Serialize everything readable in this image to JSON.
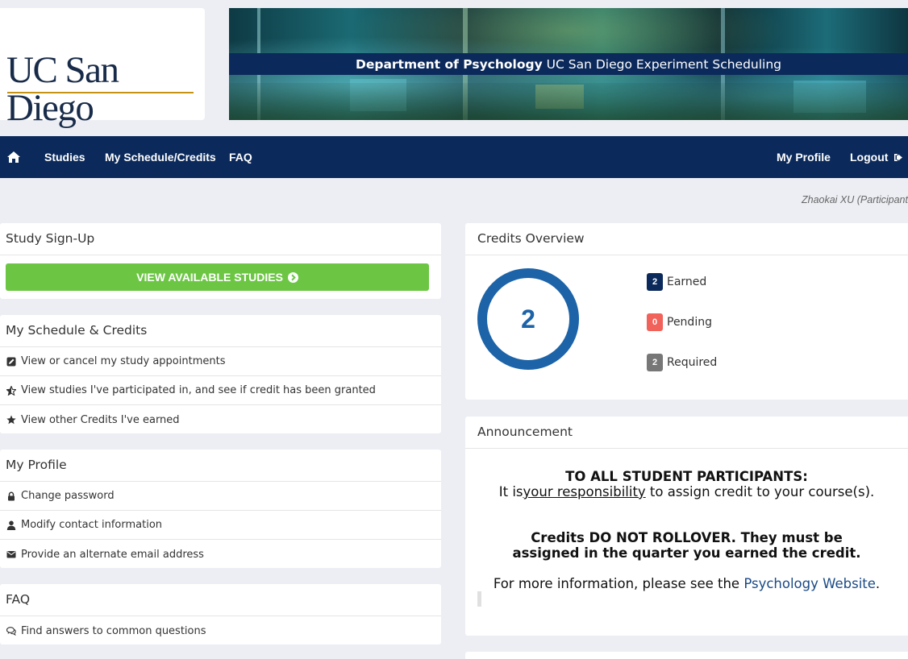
{
  "header": {
    "logo_text": "UC San Diego",
    "banner_title_bold": "Department of Psychology",
    "banner_title_rest": "UC San Diego Experiment Scheduling"
  },
  "navbar": {
    "items": [
      {
        "label": "Studies"
      },
      {
        "label": "My Schedule/Credits"
      },
      {
        "label": "FAQ"
      }
    ],
    "right": {
      "profile": "My Profile",
      "logout": "Logout"
    }
  },
  "user": {
    "display": "Zhaokai XU (Participant"
  },
  "signup": {
    "title": "Study Sign-Up",
    "button_label": "VIEW AVAILABLE STUDIES"
  },
  "schedule": {
    "title": "My Schedule & Credits",
    "items": [
      {
        "label": "View or cancel my study appointments",
        "icon": "edit-icon"
      },
      {
        "label": "View studies I've participated in, and see if credit has been granted",
        "icon": "half-star-icon"
      },
      {
        "label": "View other Credits I've earned",
        "icon": "star-icon"
      }
    ]
  },
  "profile": {
    "title": "My Profile",
    "items": [
      {
        "label": "Change password",
        "icon": "lock-icon"
      },
      {
        "label": "Modify contact information",
        "icon": "user-icon"
      },
      {
        "label": "Provide an alternate email address",
        "icon": "envelope-icon"
      }
    ]
  },
  "faq": {
    "title": "FAQ",
    "items": [
      {
        "label": "Find answers to common questions",
        "icon": "comments-icon"
      }
    ]
  },
  "credits": {
    "title": "Credits Overview",
    "total": "2",
    "earned": {
      "count": "2",
      "label": "Earned",
      "color": "#0b2a5b"
    },
    "pending": {
      "count": "0",
      "label": "Pending",
      "color": "#f0625a"
    },
    "required": {
      "count": "2",
      "label": "Required",
      "color": "#777777"
    },
    "ring_color": "#1c63a8"
  },
  "announcement": {
    "title": "Announcement",
    "heading": "TO ALL STUDENT PARTICIPANTS:",
    "line1_pre": "It is",
    "line1_link": "your responsibility",
    "line1_post": " to assign credit to your course(s).",
    "bold_line1": "Credits DO NOT ROLLOVER. They must be",
    "bold_line2": "assigned in the quarter you earned the credit.",
    "info_pre": "For more information, please see the ",
    "info_link": "Psychology Website",
    "info_post": "."
  },
  "colors": {
    "navy": "#0b2a5b",
    "green": "#6cc644",
    "gold": "#c69214"
  }
}
